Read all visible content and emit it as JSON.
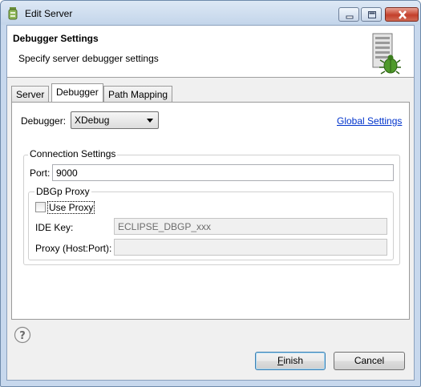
{
  "window": {
    "title": "Edit Server"
  },
  "header": {
    "title": "Debugger Settings",
    "subtitle": "Specify server debugger settings",
    "icon": "server-bug-icon"
  },
  "tabs": [
    {
      "label": "Server",
      "active": false
    },
    {
      "label": "Debugger",
      "active": true
    },
    {
      "label": "Path Mapping",
      "active": false
    }
  ],
  "debugger": {
    "label": "Debugger:",
    "selected": "XDebug",
    "global_settings_link": "Global Settings"
  },
  "connection": {
    "group_title": "Connection Settings",
    "port_label": "Port:",
    "port_value": "9000"
  },
  "proxy": {
    "group_title": "DBGp Proxy",
    "use_proxy_label": "Use Proxy",
    "use_proxy_checked": false,
    "ide_key_label": "IDE Key:",
    "ide_key_value": "ECLIPSE_DBGP_xxx",
    "host_port_label": "Proxy (Host:Port):",
    "host_port_value": ""
  },
  "footer": {
    "help_icon": "help-icon",
    "finish_label": "Finish",
    "finish_mnemonic": "F",
    "finish_rest": "inish",
    "cancel_label": "Cancel"
  }
}
